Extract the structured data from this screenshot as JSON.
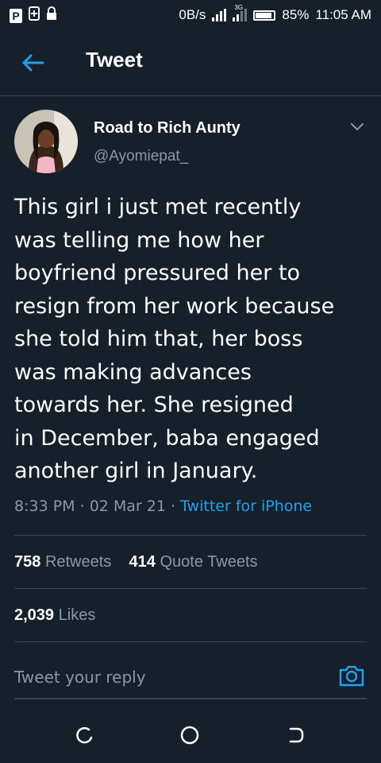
{
  "status_bar": {
    "left_icons": [
      "p-icon",
      "sim-plus-icon",
      "lock-icon"
    ],
    "net_speed": "0B/s",
    "network_type": "3G",
    "battery_percent": "85%",
    "time": "11:05 AM"
  },
  "app_bar": {
    "title": "Tweet"
  },
  "author": {
    "name": "Road to Rich Aunty",
    "handle": "@Ayomiepat_"
  },
  "tweet": {
    "text": "This girl i just met recently\nwas telling me how her\nboyfriend pressured her to\nresign from her work because\nshe told him that, her boss\nwas making advances\ntowards her. She resigned\nin December, baba engaged\nanother girl in January.",
    "time": "8:33 PM",
    "date": "02 Mar 21",
    "separator": " · ",
    "source": "Twitter for iPhone"
  },
  "stats": {
    "retweets_count": "758",
    "retweets_label": "Retweets",
    "quote_count": "414",
    "quote_label": "Quote Tweets",
    "likes_count": "2,039",
    "likes_label": "Likes"
  },
  "reply": {
    "placeholder": "Tweet your reply"
  },
  "colors": {
    "background": "#15202b",
    "accent": "#1da1f2",
    "secondary_text": "#8899a6",
    "divider": "#38444d"
  }
}
